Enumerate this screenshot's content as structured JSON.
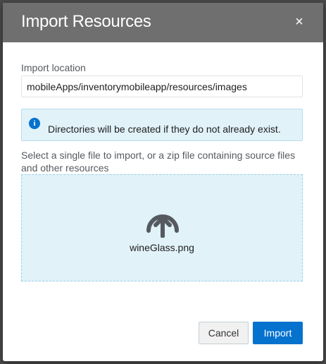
{
  "dialog": {
    "title": "Import Resources",
    "close_symbol": "×"
  },
  "location": {
    "label": "Import location",
    "value": "mobileApps/inventorymobileapp/resources/images"
  },
  "info": {
    "icon": "info-icon",
    "text": "Directories will be created if they do not already exist."
  },
  "dropzone": {
    "hint": "Select a single file to import, or a zip file containing source files and other resources",
    "icon": "upload-icon",
    "file_name": "wineGlass.png"
  },
  "buttons": {
    "cancel_label": "Cancel",
    "import_label": "Import"
  },
  "colors": {
    "header": "#6f6f6f",
    "accent": "#0572ce",
    "info_bg": "#e1f2f9"
  }
}
